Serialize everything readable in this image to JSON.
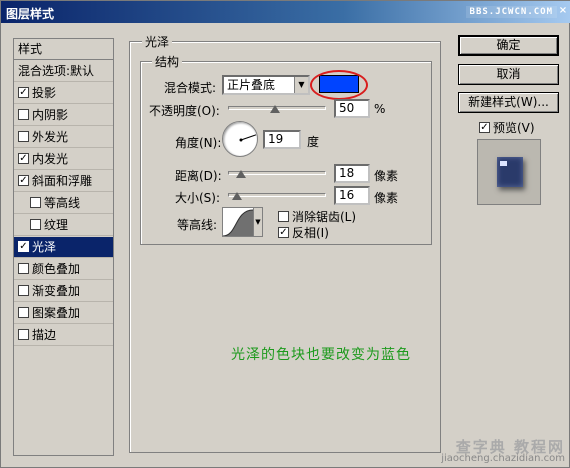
{
  "window": {
    "title": "图层样式",
    "watermark": "BBS.JCWCN.COM",
    "close_glyph": "×"
  },
  "stylelist": {
    "header": "样式",
    "items": [
      {
        "label": "混合选项:默认",
        "checkbox": false,
        "checked": false,
        "indent": false,
        "selected": false
      },
      {
        "label": "投影",
        "checkbox": true,
        "checked": true,
        "indent": false,
        "selected": false
      },
      {
        "label": "内阴影",
        "checkbox": true,
        "checked": false,
        "indent": false,
        "selected": false
      },
      {
        "label": "外发光",
        "checkbox": true,
        "checked": false,
        "indent": false,
        "selected": false
      },
      {
        "label": "内发光",
        "checkbox": true,
        "checked": true,
        "indent": false,
        "selected": false
      },
      {
        "label": "斜面和浮雕",
        "checkbox": true,
        "checked": true,
        "indent": false,
        "selected": false
      },
      {
        "label": "等高线",
        "checkbox": true,
        "checked": false,
        "indent": true,
        "selected": false
      },
      {
        "label": "纹理",
        "checkbox": true,
        "checked": false,
        "indent": true,
        "selected": false
      },
      {
        "label": "光泽",
        "checkbox": true,
        "checked": true,
        "indent": false,
        "selected": true
      },
      {
        "label": "颜色叠加",
        "checkbox": true,
        "checked": false,
        "indent": false,
        "selected": false
      },
      {
        "label": "渐变叠加",
        "checkbox": true,
        "checked": false,
        "indent": false,
        "selected": false
      },
      {
        "label": "图案叠加",
        "checkbox": true,
        "checked": false,
        "indent": false,
        "selected": false
      },
      {
        "label": "描边",
        "checkbox": true,
        "checked": false,
        "indent": false,
        "selected": false
      }
    ]
  },
  "satin": {
    "group_title": "光泽",
    "structure_title": "结构",
    "blend_mode_label": "混合模式:",
    "blend_mode_value": "正片叠底",
    "swatch_color": "#0044ff",
    "opacity_label": "不透明度(O):",
    "opacity_value": "50",
    "opacity_unit": "%",
    "angle_label": "角度(N):",
    "angle_value": "19",
    "angle_unit": "度",
    "distance_label": "距离(D):",
    "distance_value": "18",
    "distance_unit": "像素",
    "size_label": "大小(S):",
    "size_value": "16",
    "size_unit": "像素",
    "contour_label": "等高线:",
    "antialias_label": "消除锯齿(L)",
    "antialias_checked": false,
    "invert_label": "反相(I)",
    "invert_checked": true
  },
  "buttons": {
    "ok": "确定",
    "cancel": "取消",
    "new_style": "新建样式(W)...",
    "preview_label": "预览(V)",
    "preview_checked": true
  },
  "annotation": "光泽的色块也要改变为蓝色",
  "bottom_watermark": {
    "line1": "查字典 教程网",
    "line2": "jiaocheng.chazidian.com"
  },
  "colors": {
    "selection": "#0a246a",
    "annotation": "#1d9a1d",
    "highlight_circle": "#d81e1e"
  }
}
